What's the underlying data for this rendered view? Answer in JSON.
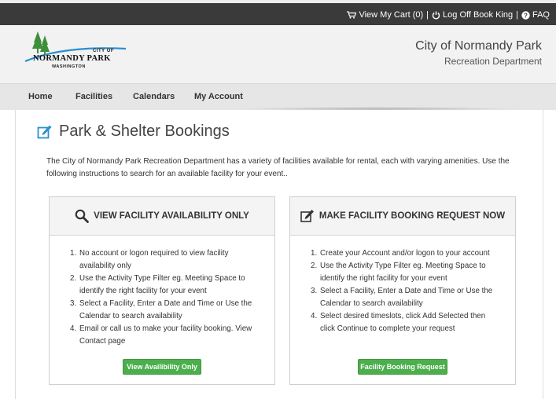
{
  "topbar": {
    "cart_label": "View My Cart (0)",
    "separator": "|",
    "logoff_label": "Log Off Book King",
    "faq_label": "FAQ"
  },
  "header": {
    "logo_city_of": "CITY OF",
    "logo_name": "NORMANDY PARK",
    "logo_state": "WASHINGTON",
    "title": "City of Normandy Park",
    "subtitle": "Recreation Department"
  },
  "nav": {
    "items": [
      {
        "label": "Home"
      },
      {
        "label": "Facilities"
      },
      {
        "label": "Calendars"
      },
      {
        "label": "My Account"
      }
    ]
  },
  "page": {
    "title": "Park & Shelter Bookings",
    "intro": "The City of Normandy Park Recreation Department has a variety of facilities available for rental, each with varying amenities. Use the following instructions to search for an available facility for your event.."
  },
  "panels": [
    {
      "title": "VIEW FACILITY AVAILABILITY ONLY",
      "icon": "search-icon",
      "steps": [
        {
          "num": "1.",
          "text": "No account or logon required to view facility availability only"
        },
        {
          "num": "2.",
          "text": "Use the Activity Type Filter eg. Meeting Space to identify the right facility for your event"
        },
        {
          "num": "3.",
          "text": "Select a Facility, Enter a Date and Time or Use the Calendar to search availability"
        },
        {
          "num": "4.",
          "text": "Email or call us to make your facility booking. View Contact page"
        }
      ],
      "button_label": "View Availibility Only"
    },
    {
      "title": "MAKE FACILITY BOOKING REQUEST NOW",
      "icon": "edit-icon",
      "steps": [
        {
          "num": "1.",
          "text": "Create your Account and/or logon to your account"
        },
        {
          "num": "2.",
          "text": "Use the Activity Type Filter eg. Meeting Space to identify the right facility for your event"
        },
        {
          "num": "3.",
          "text": "Select a Facility, Enter a Date and Time or Use the Calendar to search availability"
        },
        {
          "num": "4.",
          "text": "Select desired timeslots, click Add Selected then click Continue to complete your request"
        }
      ],
      "button_label": "Facility Booking Request"
    }
  ],
  "colors": {
    "topbar": "#3a3a3a",
    "accent_blue": "#2b8fcf",
    "button_green": "#4cae4c"
  }
}
